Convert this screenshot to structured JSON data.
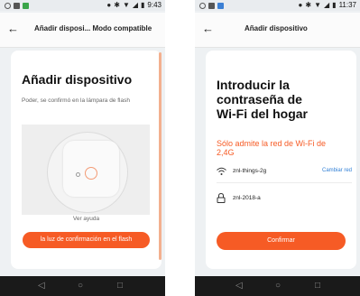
{
  "colors": {
    "accent": "#f65b25",
    "link": "#2f7fd6"
  },
  "screen1": {
    "status": {
      "time": "9:43"
    },
    "header": {
      "title": "Añadir disposi... Modo compatible"
    },
    "card": {
      "heading": "Añadir dispositivo",
      "instruction": "Poder, se confirmó en la lámpara de flash",
      "help_link": "Ver ayuda",
      "confirm_button": "la luz de confirmación en el flash"
    },
    "icons": [
      "back-arrow-icon",
      "power-icon"
    ]
  },
  "screen2": {
    "status": {
      "time": "11:37"
    },
    "header": {
      "title": "Añadir dispositivo"
    },
    "card": {
      "heading_line1": "Introducir la",
      "heading_line2": "contraseña de",
      "heading_line3": "Wi-Fi del hogar",
      "note_line1": "Sólo admite la red de Wi-Fi de",
      "note_line2": "2,4G",
      "wifi_name": "znl-things-2g",
      "change_network": "Cambiar red",
      "password": "znl-2018-a",
      "confirm_button": "Confirmar"
    },
    "icons": [
      "back-arrow-icon",
      "wifi-icon",
      "lock-icon"
    ]
  }
}
